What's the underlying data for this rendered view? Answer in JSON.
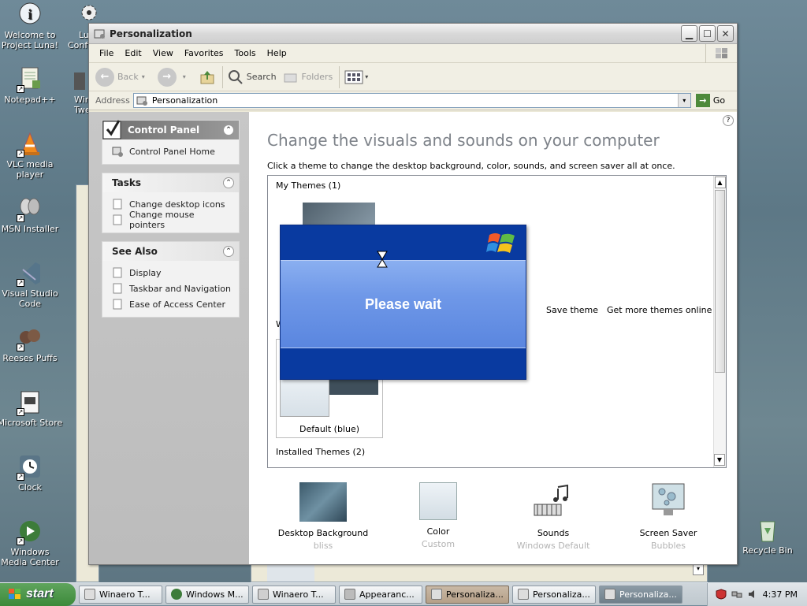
{
  "desktop": {
    "icons": [
      {
        "label": "Welcome to Project Luna!",
        "icon": "info-icon"
      },
      {
        "label": "Notepad++",
        "icon": "notepad-icon"
      },
      {
        "label": "VLC media player",
        "icon": "vlc-cone-icon"
      },
      {
        "label": "MSN Installer",
        "icon": "msn-butterfly-icon"
      },
      {
        "label": "Visual Studio Code",
        "icon": "vscode-icon"
      },
      {
        "label": "Reeses Puffs",
        "icon": "reeses-icon"
      },
      {
        "label": "Microsoft Store",
        "icon": "store-icon"
      },
      {
        "label": "Clock",
        "icon": "clock-icon"
      },
      {
        "label": "Windows Media Center",
        "icon": "media-center-icon"
      }
    ],
    "col2_partial": {
      "label_top": "Lu",
      "label_bot": "Confi",
      "label_mid1": "Win",
      "label_mid2": "Twe"
    },
    "recycle_bin": "Recycle Bin"
  },
  "window": {
    "title": "Personalization",
    "menu": [
      "File",
      "Edit",
      "View",
      "Favorites",
      "Tools",
      "Help"
    ],
    "toolbar": {
      "back": "Back",
      "search": "Search",
      "folders": "Folders"
    },
    "address": {
      "label": "Address",
      "value": "Personalization",
      "go": "Go"
    }
  },
  "leftpane": {
    "control_panel": {
      "title": "Control Panel",
      "link": "Control Panel Home"
    },
    "tasks": {
      "title": "Tasks",
      "links": [
        "Change desktop icons",
        "Change mouse pointers"
      ]
    },
    "see_also": {
      "title": "See Also",
      "links": [
        "Display",
        "Taskbar and Navigation",
        "Ease of Access Center"
      ]
    }
  },
  "main": {
    "heading": "Change the visuals and sounds on your computer",
    "subtext": "Click a theme to change the desktop background, color, sounds, and screen saver all at once.",
    "my_themes": "My Themes (1)",
    "save_theme": "Save theme",
    "get_more": "Get more themes online",
    "default_theme": "Default (blue)",
    "installed_themes": "Installed Themes (2)",
    "partial_letter": "W",
    "bottom": [
      {
        "label": "Desktop Background",
        "sub": "bliss",
        "icon": "desktop-background-thumbnail"
      },
      {
        "label": "Color",
        "sub": "Custom",
        "icon": "color-swatch"
      },
      {
        "label": "Sounds",
        "sub": "Windows Default",
        "icon": "music-notes-icon"
      },
      {
        "label": "Screen Saver",
        "sub": "Bubbles",
        "icon": "screensaver-monitor-icon"
      }
    ]
  },
  "please_wait": {
    "text": "Please wait"
  },
  "taskbar": {
    "start": "start",
    "buttons": [
      "Winaero T...",
      "Windows M...",
      "Winaero T...",
      "Appearanc...",
      "Personaliza...",
      "Personaliza...",
      "Personaliza..."
    ],
    "clock": "4:37 PM"
  },
  "colors": {
    "xp_blue": "#093aa0",
    "panel_gray": "#bcbcbc",
    "heading_gray": "#7d8289"
  }
}
